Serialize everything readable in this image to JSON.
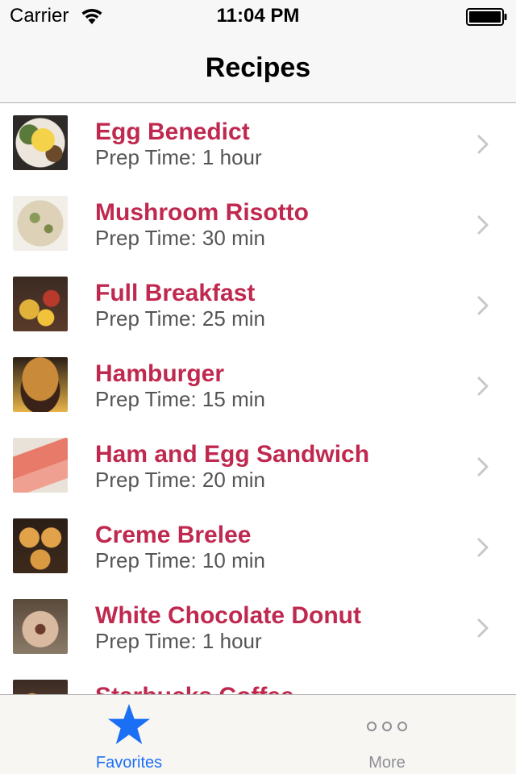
{
  "status_bar": {
    "carrier": "Carrier",
    "time": "11:04 PM",
    "wifi_icon": "wifi-icon",
    "battery_icon": "battery-icon"
  },
  "nav": {
    "title": "Recipes"
  },
  "recipes": [
    {
      "name": "Egg Benedict",
      "prep": "Prep Time: 1 hour"
    },
    {
      "name": "Mushroom Risotto",
      "prep": "Prep Time: 30 min"
    },
    {
      "name": "Full Breakfast",
      "prep": "Prep Time: 25 min"
    },
    {
      "name": "Hamburger",
      "prep": "Prep Time: 15 min"
    },
    {
      "name": "Ham and Egg Sandwich",
      "prep": "Prep Time: 20 min"
    },
    {
      "name": "Creme Brelee",
      "prep": "Prep Time: 10 min"
    },
    {
      "name": "White Chocolate Donut",
      "prep": "Prep Time: 1 hour"
    },
    {
      "name": "Starbucks Coffee",
      "prep": ""
    }
  ],
  "tab_bar": {
    "tabs": [
      {
        "label": "Favorites",
        "icon": "star-icon",
        "selected": true
      },
      {
        "label": "More",
        "icon": "more-icon",
        "selected": false
      }
    ]
  },
  "colors": {
    "recipe_title": "#c0294f",
    "subtitle": "#555555",
    "tab_active": "#1b6ff5",
    "tab_inactive": "#8e8e93",
    "chevron": "#c7c7cc"
  }
}
